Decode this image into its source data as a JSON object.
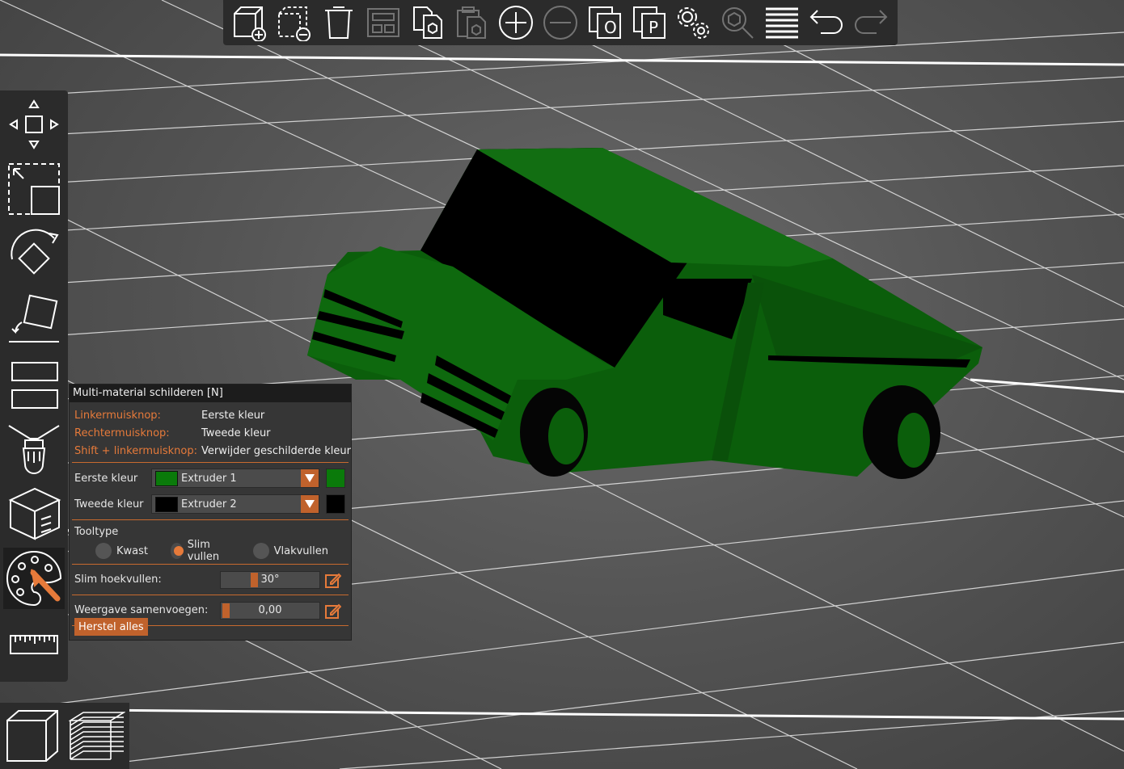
{
  "toolbar": {
    "buttons": [
      {
        "icon": "add-object-icon",
        "enabled": true
      },
      {
        "icon": "remove-object-icon",
        "enabled": true
      },
      {
        "icon": "delete-icon",
        "enabled": true
      },
      {
        "icon": "arrange-icon",
        "enabled": false
      },
      {
        "icon": "copy-object-icon",
        "enabled": true
      },
      {
        "icon": "paste-object-icon",
        "enabled": false
      },
      {
        "icon": "add-instance-icon",
        "enabled": true
      },
      {
        "icon": "remove-instance-icon",
        "enabled": false
      },
      {
        "icon": "split-objects-icon",
        "enabled": true
      },
      {
        "icon": "split-parts-icon",
        "enabled": true
      },
      {
        "icon": "variable-layer-height-icon",
        "enabled": true
      },
      {
        "icon": "search-icon",
        "enabled": false
      },
      {
        "icon": "layer-editing-icon",
        "enabled": true
      },
      {
        "icon": "undo-icon",
        "enabled": true
      },
      {
        "icon": "redo-icon",
        "enabled": false
      }
    ]
  },
  "colors": {
    "accent": "#c0622c",
    "model": "#0d6b0d",
    "extruder1": "#0a7a0a",
    "extruder2": "#000000"
  },
  "panel": {
    "title": "Multi-material schilderen [N]",
    "hints": [
      {
        "key": "Linkermuisknop:",
        "value": "Eerste kleur"
      },
      {
        "key": "Rechtermuisknop:",
        "value": "Tweede kleur"
      },
      {
        "key": "Shift + linkermuisknop:",
        "value": "Verwijder geschilderde kleur"
      }
    ],
    "first_color": {
      "label": "Eerste kleur",
      "value": "Extruder 1"
    },
    "second_color": {
      "label": "Tweede kleur",
      "value": "Extruder 2"
    },
    "tooltype": {
      "label": "Tooltype",
      "options": [
        "Kwast",
        "Slim vullen",
        "Vlakvullen"
      ],
      "selected": "Slim vullen"
    },
    "smart_fill_angle": {
      "label": "Slim hoekvullen:",
      "value": "30°",
      "fraction": 0.33
    },
    "seam_merge": {
      "label": "Weergave samenvoegen:",
      "value": "0,00",
      "fraction": 0.0
    },
    "reset_label": "Herstel alles"
  }
}
